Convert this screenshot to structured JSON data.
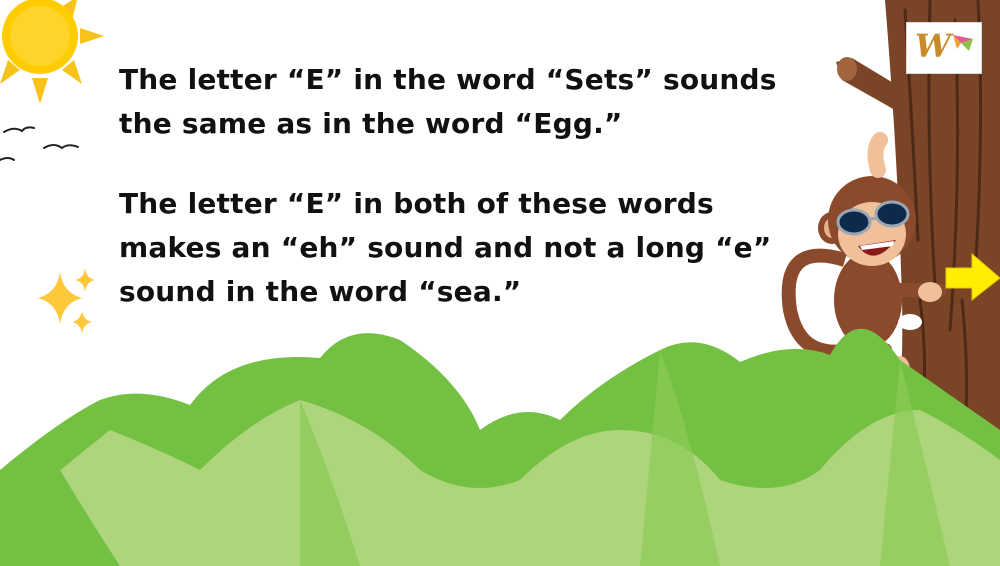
{
  "slide": {
    "paragraph_1": "The letter “E” in the word “Sets” sounds the same as in the word “Egg.”",
    "paragraph_2": "The letter “E” in both of these words makes an “eh” sound and not a long “e” sound in the word “sea.”"
  },
  "logo": {
    "text": "W"
  },
  "icons": [
    "sun-icon",
    "bird-icon",
    "sparkle-icon",
    "monkey-illustration",
    "tree-trunk",
    "arrow-right-icon",
    "mountains"
  ],
  "colors": {
    "sun": "#ffcc00",
    "mountain_dark": "#74c043",
    "mountain_light": "#aed57c",
    "tree": "#7a4427",
    "monkey": "#8b4a2b",
    "arrow": "#ffee00",
    "text": "#111111"
  }
}
